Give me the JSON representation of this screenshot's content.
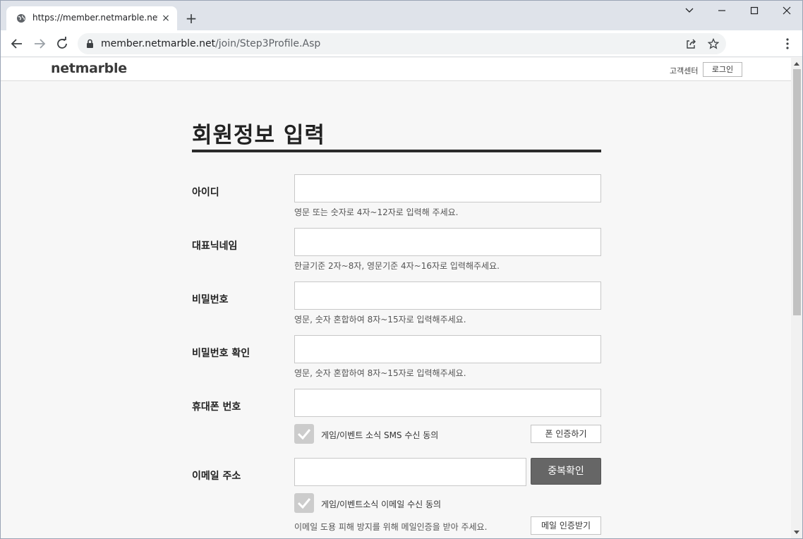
{
  "browser": {
    "tab_title": "https://member.netmarble.net/jo",
    "tab_close": "×",
    "new_tab": "+",
    "url_host": "member.netmarble.net",
    "url_path": "/join/Step3Profile.Asp"
  },
  "site": {
    "logo": "netmarble",
    "customer_center": "고객센터",
    "login": "로그인"
  },
  "form": {
    "title": "회원정보 입력",
    "fields": {
      "id": {
        "label": "아이디",
        "value": "",
        "hint": "영문 또는 숫자로 4자~12자로 입력해 주세요."
      },
      "nickname": {
        "label": "대표닉네임",
        "value": "",
        "hint": "한글기준 2자~8자, 영문기준 4자~16자로 입력해주세요."
      },
      "password": {
        "label": "비밀번호",
        "value": "",
        "hint": "영문, 숫자 혼합하여 8자~15자로 입력해주세요."
      },
      "password_confirm": {
        "label": "비밀번호 확인",
        "value": "",
        "hint": "영문, 숫자 혼합하여 8자~15자로 입력해주세요."
      },
      "phone": {
        "label": "휴대폰 번호",
        "value": "",
        "sms_consent": "게임/이벤트 소식 SMS 수신 동의",
        "verify_button": "폰 인증하기"
      },
      "email": {
        "label": "이메일 주소",
        "value": "",
        "duplicate_check": "중복확인",
        "email_consent": "게임/이벤트소식 이메일 수신 동의",
        "hint": "이메일 도용 피해 방지를 위해 메일인증을 받아 주세요.",
        "verify_button": "메일 인증받기"
      }
    }
  },
  "colors": {
    "tabstrip_bg": "#dfe3ea",
    "page_bg": "#f7f7f7",
    "dark_button": "#666666",
    "checkbox": "#cccccc"
  }
}
